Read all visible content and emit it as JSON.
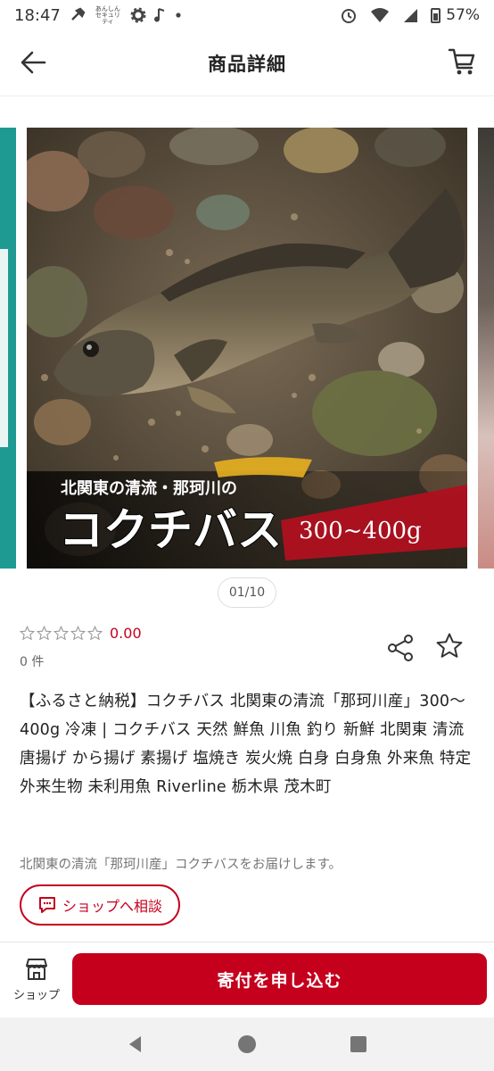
{
  "status_bar": {
    "time": "18:47",
    "small_app_label": "あんしんセキュリティ",
    "battery": "57%"
  },
  "header": {
    "title": "商品詳細",
    "back_icon": "arrow-left-icon",
    "cart_icon": "cart-icon"
  },
  "product_image": {
    "overlay_subtitle": "北関東の清流・那珂川の",
    "overlay_title": "コクチバス",
    "overlay_weight": "300~400g"
  },
  "pager": "01/10",
  "rating": {
    "stars_filled": 0,
    "stars_total": 5,
    "score": "0.00",
    "count": "0 件"
  },
  "product": {
    "title": "【ふるさと納税】コクチバス 北関東の清流「那珂川産」300〜400g 冷凍 | コクチバス 天然 鮮魚 川魚 釣り 新鮮 北関東 清流 唐揚げ から揚げ 素揚げ 塩焼き 炭火焼 白身 白身魚 外来魚 特定外来生物 未利用魚 Riverline 栃木県 茂木町",
    "description": "北関東の清流「那珂川産」コクチバスをお届けします。"
  },
  "consult_button": "ショップへ相談",
  "bottom_bar": {
    "shop_label": "ショップ",
    "apply_label": "寄付を申し込む"
  },
  "colors": {
    "accent": "#c4001d",
    "teal": "#1f9a93"
  }
}
